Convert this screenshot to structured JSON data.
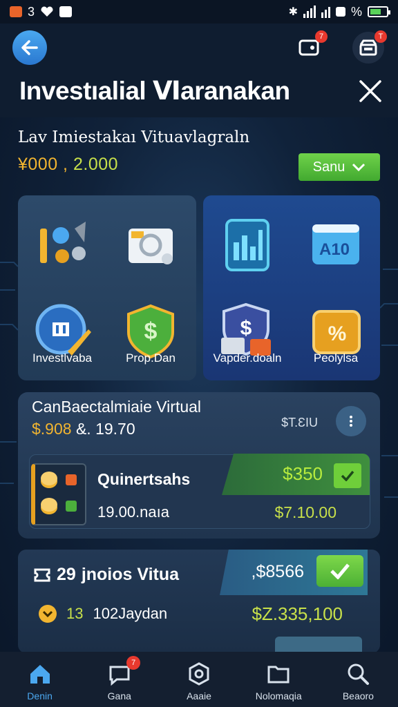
{
  "status_bar": {
    "left_number": "3",
    "battery_label": "%"
  },
  "header": {
    "title": "Investıalial Ⅵaranakan",
    "notif_badge": "7",
    "store_badge": "T"
  },
  "summary": {
    "label": "Lav Imiestakaı Vituavlagraln",
    "value_primary": "¥000 ,",
    "value_secondary": "2.000",
    "save_label": "Sanu"
  },
  "features": [
    {
      "label": "Investlvaba",
      "icon": "tools-icon"
    },
    {
      "label": "",
      "icon": "camera-icon"
    },
    {
      "label": "",
      "icon": "bank-icon"
    },
    {
      "label": "Prop.Dan",
      "icon": "shield-dollar-icon"
    },
    {
      "label": "",
      "icon": "chart-tablet-icon"
    },
    {
      "label": "",
      "icon": "data-box-icon"
    },
    {
      "label": "Vapder.doaln",
      "icon": "money-shield-icon"
    },
    {
      "label": "Peolylsa",
      "icon": "percent-coin-icon"
    }
  ],
  "portfolio": {
    "title": "CanBaectalmiaie Virtual",
    "sub_a": "$.908",
    "sub_b": "&. 19.70",
    "right_value": "$T.ƐIU",
    "asset": {
      "name": "Quinertsahs",
      "qty": "19.00.naıa",
      "price": "$350",
      "value": "$7.10.00"
    }
  },
  "card2": {
    "title_num": "29",
    "title": "jnoios Vitua",
    "price": ",$8566",
    "meta_num": "13",
    "meta_text": "102Jaydan",
    "value": "$Z.335,100"
  },
  "nav": [
    {
      "label": "Denin",
      "icon": "home-icon",
      "active": true
    },
    {
      "label": "Gana",
      "icon": "chat-icon",
      "badge": "7"
    },
    {
      "label": "Aaaie",
      "icon": "hexagon-icon"
    },
    {
      "label": "Nolomaqia",
      "icon": "folder-icon"
    },
    {
      "label": "Beaoro",
      "icon": "search-icon"
    }
  ],
  "colors": {
    "accent_blue": "#4ba8f0",
    "gold": "#f2b530",
    "lime": "#c8e04a",
    "green": "#6fcf3a",
    "bg": "#10223a"
  }
}
